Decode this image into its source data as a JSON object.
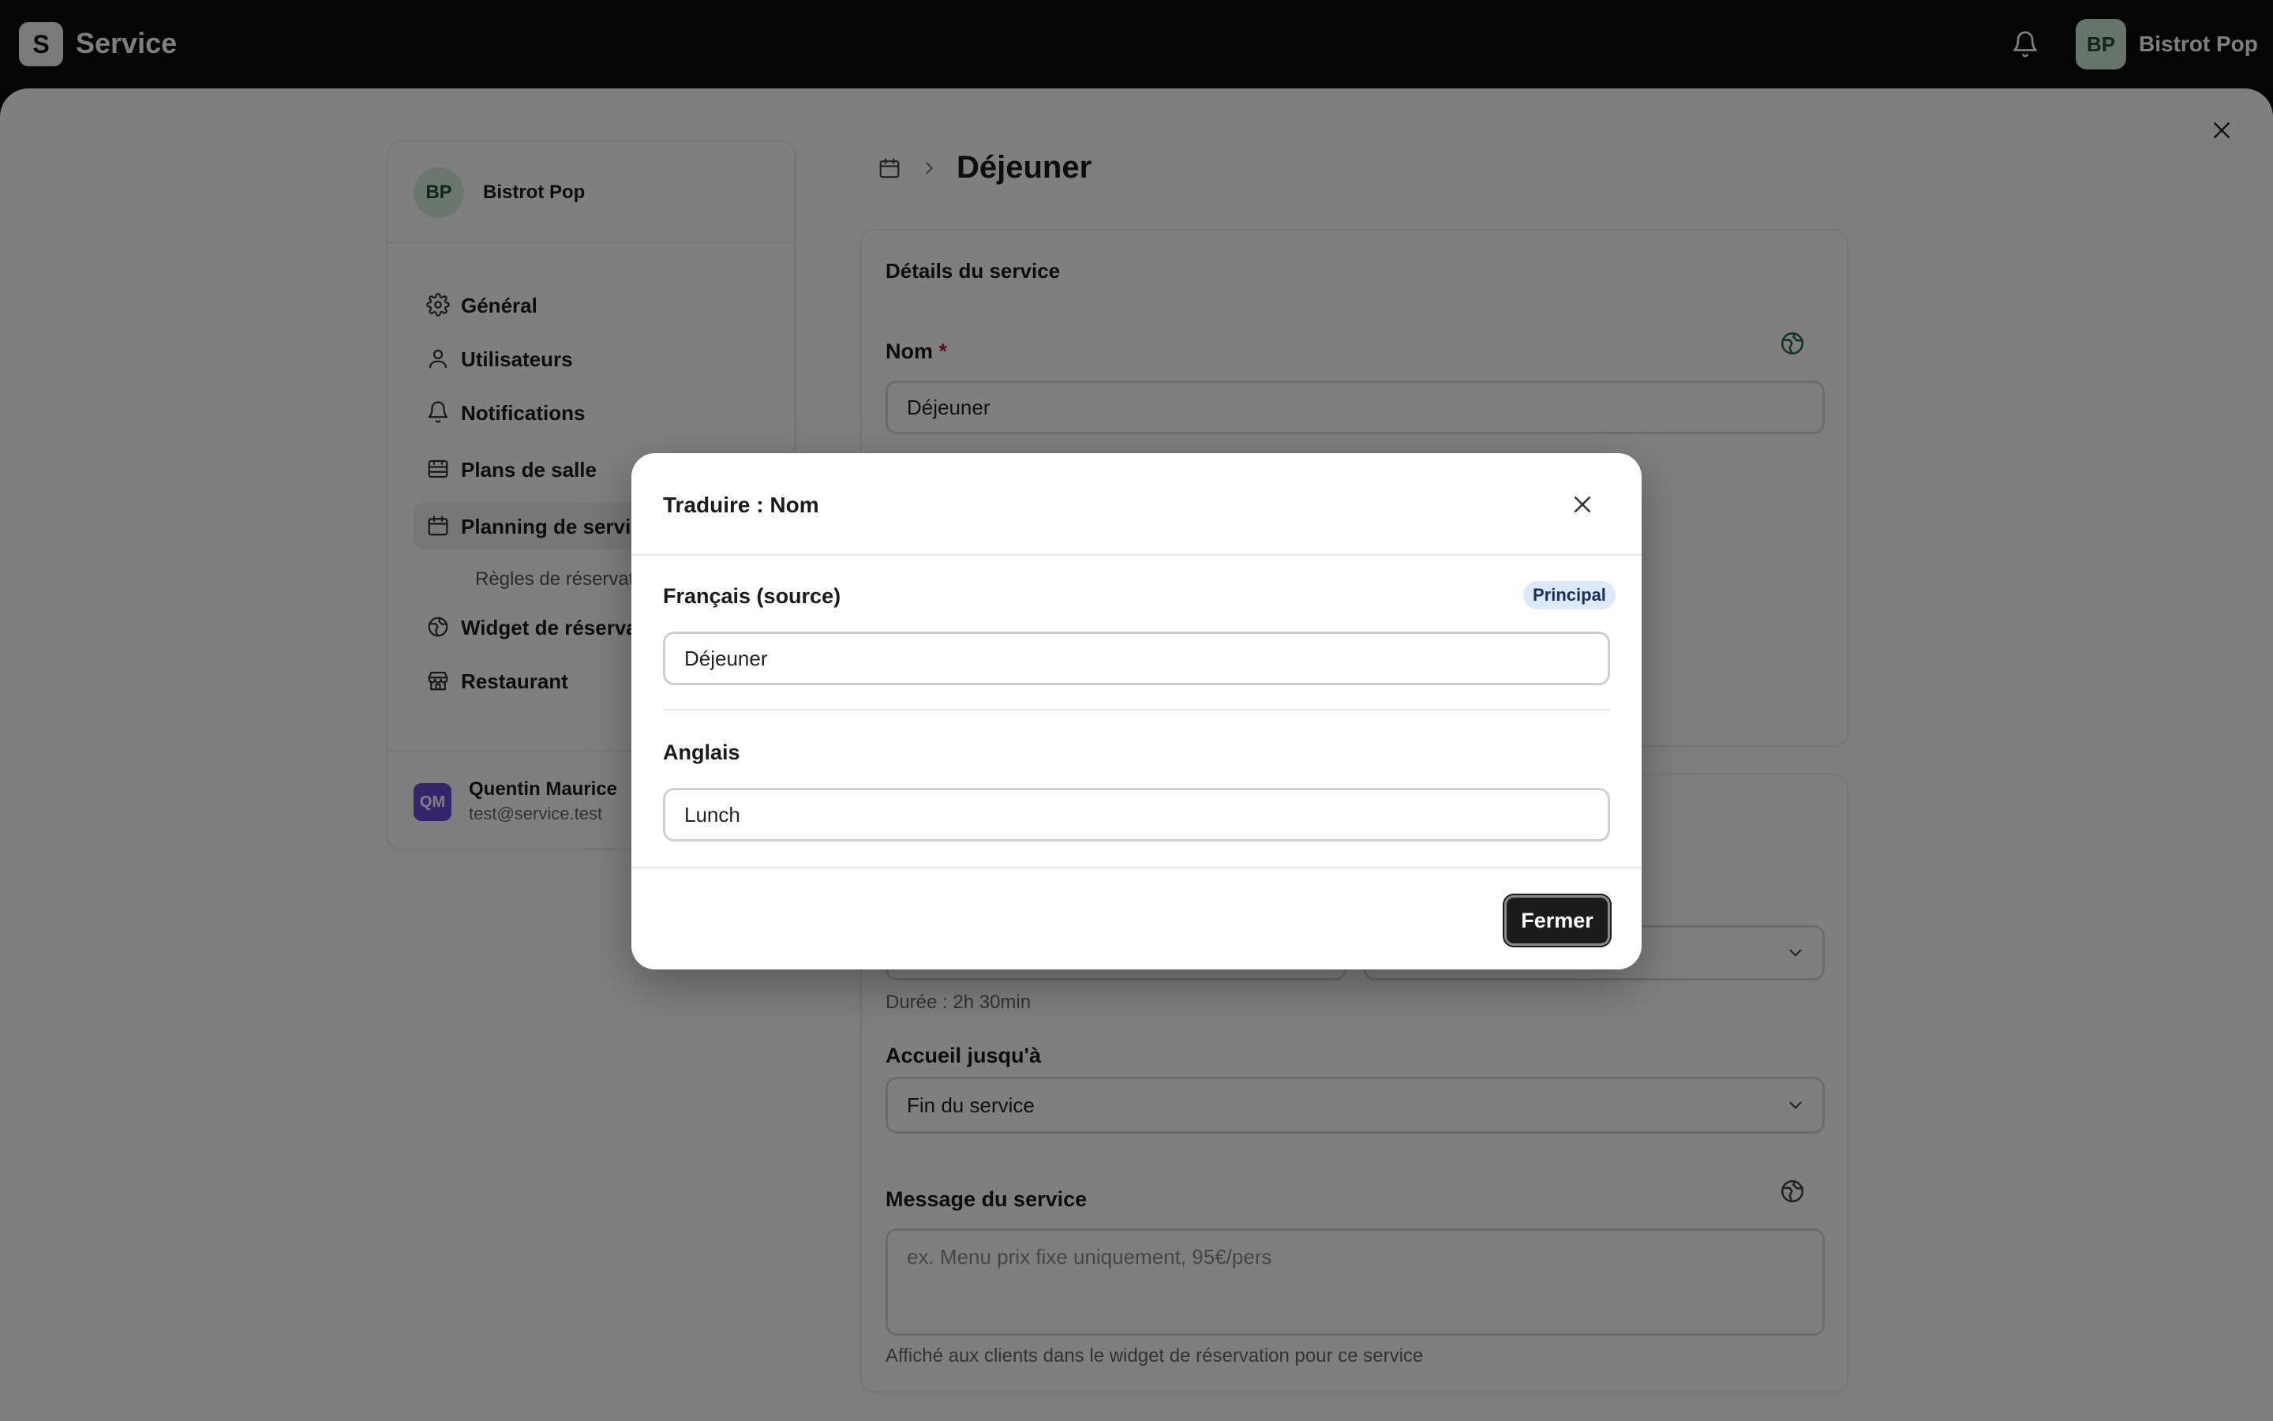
{
  "app": {
    "logo_letter": "S",
    "title": "Service"
  },
  "header": {
    "user_initials": "BP",
    "user_name": "Bistrot Pop"
  },
  "sidebar": {
    "org_initials": "BP",
    "org_name": "Bistrot Pop",
    "items": [
      {
        "label": "Général",
        "icon": "gear-icon"
      },
      {
        "label": "Utilisateurs",
        "icon": "user-icon"
      },
      {
        "label": "Notifications",
        "icon": "bell-icon"
      },
      {
        "label": "Plans de salle",
        "icon": "floorplan-icon"
      },
      {
        "label": "Planning de services",
        "icon": "calendar-icon",
        "active": true
      },
      {
        "label": "Widget de réservation",
        "icon": "globe-icon"
      },
      {
        "label": "Restaurant",
        "icon": "store-icon"
      }
    ],
    "sub_item": "Règles de réservation",
    "footer": {
      "initials": "QM",
      "name": "Quentin Maurice",
      "email": "test@service.test"
    }
  },
  "main": {
    "breadcrumb_title": "Déjeuner",
    "details_card": {
      "title": "Détails du service",
      "name_label": "Nom",
      "name_required": "*",
      "name_value": "Déjeuner"
    },
    "schedule_card": {
      "duration_text": "Durée : 2h 30min",
      "welcome_label": "Accueil jusqu'à",
      "welcome_value": "Fin du service",
      "message_label": "Message du service",
      "message_placeholder": "ex. Menu prix fixe uniquement, 95€/pers",
      "message_help": "Affiché aux clients dans le widget de réservation pour ce service"
    }
  },
  "modal": {
    "title": "Traduire : Nom",
    "source_label": "Français (source)",
    "source_badge": "Principal",
    "source_value": "Déjeuner",
    "target_label": "Anglais",
    "target_value": "Lunch",
    "close_button": "Fermer"
  },
  "colors": {
    "accent_green": "#1f6b45",
    "badge_bg": "#dce8fb",
    "primary_button": "#1b1b1b"
  }
}
